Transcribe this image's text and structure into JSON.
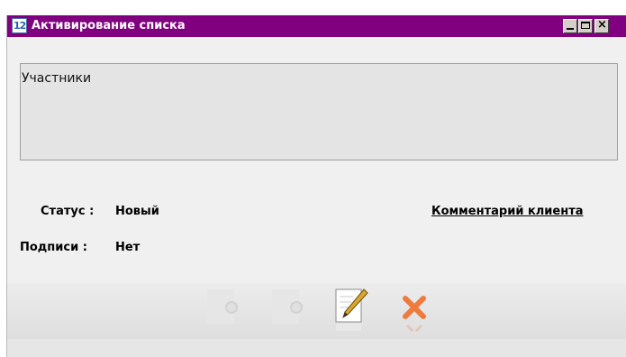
{
  "window": {
    "title": "Активирование списка",
    "app_icon_glyph": "12",
    "titlebar_color": "#800080"
  },
  "participants": {
    "label": "Участники"
  },
  "fields": {
    "status_label": "Статус :",
    "status_value": "Новый",
    "signatures_label": "Подписи :",
    "signatures_value": "Нет"
  },
  "links": {
    "client_comment": "Комментарий клиента"
  },
  "toolbar": {
    "icons": [
      "document-action-icon",
      "document-action-icon",
      "edit-pencil-icon",
      "delete-x-icon"
    ],
    "delete_color": "#f07a3c"
  }
}
